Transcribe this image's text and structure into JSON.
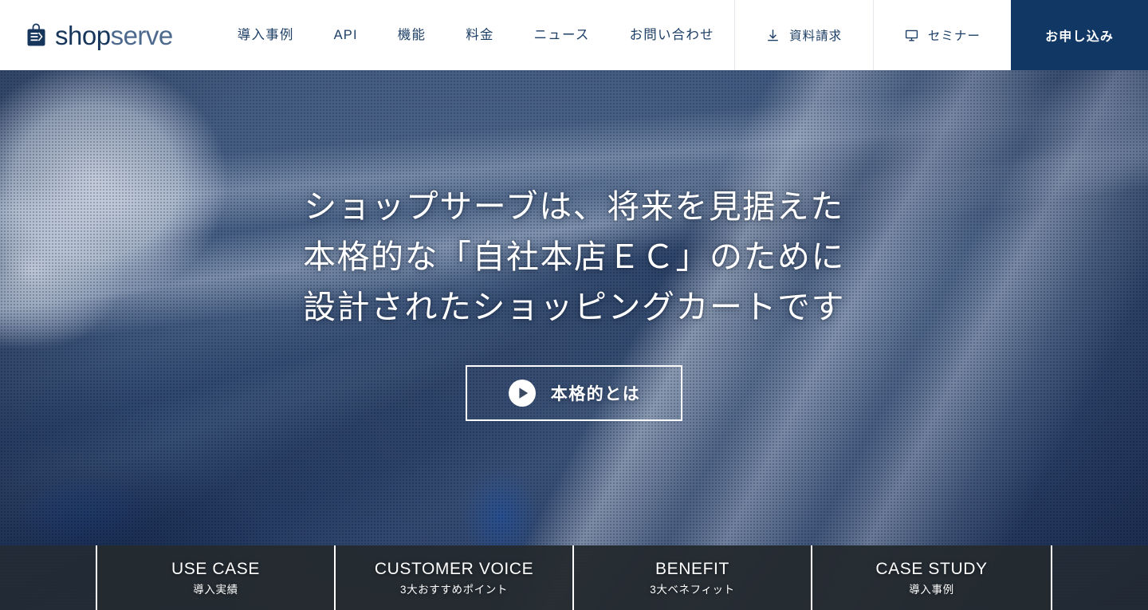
{
  "site": {
    "brand_name": "shopserve",
    "brand_name_bold": "shop",
    "brand_name_light": "serve",
    "brand_icon": "shopping-bag-icon",
    "accent_navy": "#113764",
    "nav_text_color": "#1d3f66"
  },
  "header": {
    "nav_items": [
      {
        "label": "導入事例"
      },
      {
        "label": "API"
      },
      {
        "label": "機能"
      },
      {
        "label": "料金"
      },
      {
        "label": "ニュース"
      },
      {
        "label": "お問い合わせ"
      }
    ],
    "actions": [
      {
        "label": "資料請求",
        "icon": "download-icon"
      },
      {
        "label": "セミナー",
        "icon": "monitor-icon"
      }
    ],
    "apply_label": "お申し込み"
  },
  "hero": {
    "heading_lines": [
      "ショップサーブは、将来を見据えた",
      "本格的な「自社本店ＥＣ」のために",
      "設計されたショッピングカートです"
    ],
    "cta_label": "本格的とは",
    "cta_icon": "play-circle-icon"
  },
  "bottom_cards": [
    {
      "en": "USE CASE",
      "jp": "導入実績"
    },
    {
      "en": "CUSTOMER VOICE",
      "jp": "3大おすすめポイント"
    },
    {
      "en": "BENEFIT",
      "jp": "3大ベネフィット"
    },
    {
      "en": "CASE STUDY",
      "jp": "導入事例"
    }
  ]
}
